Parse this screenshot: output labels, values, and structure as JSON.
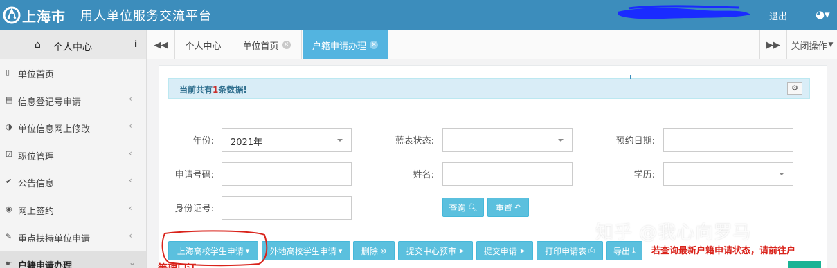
{
  "header": {
    "city": "上海市",
    "title": "用人单位服务交流平台",
    "logout": "退出",
    "brand_color": "#3c8dbc"
  },
  "sidebar": {
    "title": "个人中心",
    "info_icon": "i",
    "items": [
      {
        "icon": "bookmark-icon",
        "label": "单位首页",
        "has_chevron": false
      },
      {
        "icon": "copy-icon",
        "label": "信息登记号申请",
        "has_chevron": true
      },
      {
        "icon": "adjust-icon",
        "label": "单位信息网上修改",
        "has_chevron": true
      },
      {
        "icon": "check-square-icon",
        "label": "职位管理",
        "has_chevron": true
      },
      {
        "icon": "check-icon",
        "label": "公告信息",
        "has_chevron": true
      },
      {
        "icon": "eye-icon",
        "label": "网上签约",
        "has_chevron": true
      },
      {
        "icon": "pencil-icon",
        "label": "重点扶持单位申请",
        "has_chevron": true
      },
      {
        "icon": "hand-icon",
        "label": "户籍申请办理",
        "has_chevron": true
      }
    ]
  },
  "tabs": {
    "items": [
      {
        "label": "个人中心",
        "closable": false,
        "active": false
      },
      {
        "label": "单位首页",
        "closable": true,
        "active": false
      },
      {
        "label": "户籍申请办理",
        "closable": true,
        "active": true
      }
    ],
    "close_ops": "关闭操作"
  },
  "main": {
    "alert_prefix": "当前共有",
    "alert_count": "1",
    "alert_suffix": "条数据!",
    "form": {
      "year_label": "年份:",
      "year_value": "2021年",
      "blue_status_label": "蓝表状态:",
      "blue_status_value": "",
      "appt_date_label": "预约日期:",
      "appt_date_value": "",
      "app_no_label": "申请号码:",
      "app_no_value": "",
      "name_label": "姓名:",
      "name_value": "",
      "edu_label": "学历:",
      "edu_value": "",
      "id_label": "身份证号:",
      "id_value": ""
    },
    "query_btn": "查询",
    "reset_btn": "重置",
    "toolbar": {
      "sh_student": "上海高校学生申请",
      "other_student": "外地高校学生申请",
      "delete": "删除",
      "submit_center": "提交中心预审",
      "submit_app": "提交申请",
      "print": "打印申请表",
      "export": "导出"
    },
    "red_note": "若查询最新户籍申请状态，请前往户",
    "bottom_red": "等理口江",
    "accent_color": "#5bc0de"
  },
  "watermark": "知乎 @我心向罗马"
}
